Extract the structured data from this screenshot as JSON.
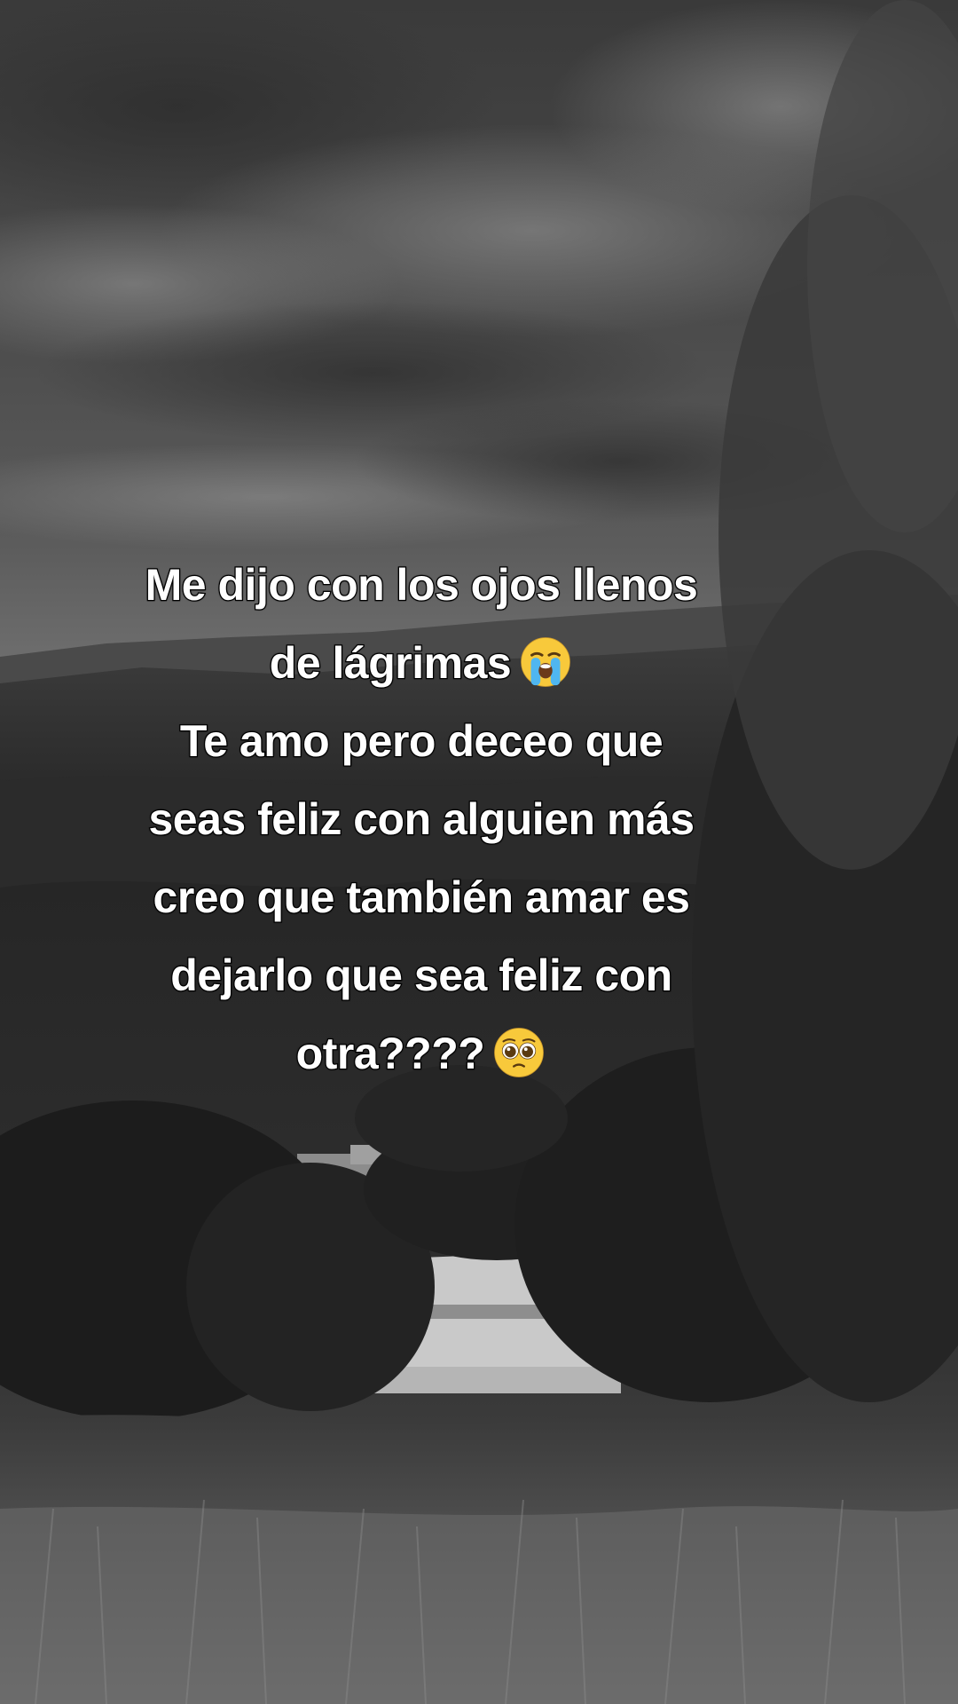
{
  "caption": {
    "line1": "Me dijo con los ojos llenos",
    "line2": "de lágrimas",
    "line3": "Te amo pero deceo que",
    "line4": "seas feliz con alguien más",
    "line5": "creo que también amar es",
    "line6": "dejarlo que sea feliz con",
    "line7": "otra????",
    "emoji_1": "loudly-crying-face-icon",
    "emoji_2": "pleading-face-icon"
  },
  "colors": {
    "text": "#ffffff",
    "text_outline": "#000000",
    "emoji_yellow": "#f8c93b",
    "tear_blue": "#4fb6f0"
  }
}
